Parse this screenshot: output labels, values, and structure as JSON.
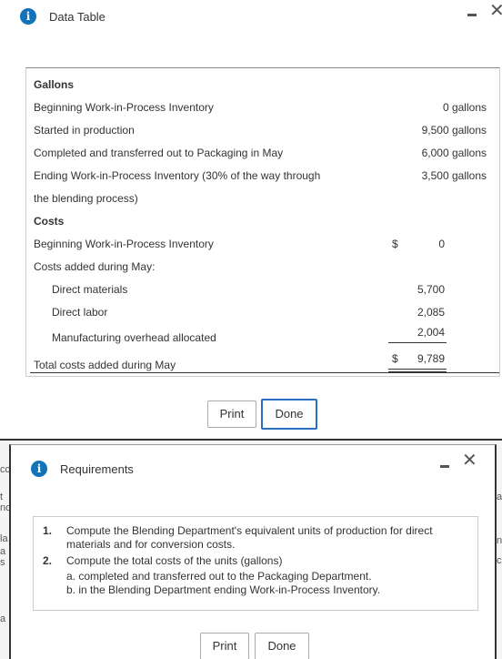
{
  "data_table": {
    "title": "Data Table",
    "sections": {
      "gallons_header": "Gallons",
      "costs_header": "Costs"
    },
    "rows": {
      "beginning_wip": {
        "label": "Beginning Work-in-Process Inventory",
        "value": "0 gallons"
      },
      "started": {
        "label": "Started in production",
        "value": "9,500 gallons"
      },
      "completed": {
        "label": "Completed and transferred out to Packaging in May",
        "value": "6,000 gallons"
      },
      "ending_wip_line1": "Ending Work-in-Process Inventory (30% of the way through",
      "ending_wip_line2": "the blending process)",
      "ending_wip_value": "3,500 gallons",
      "costs_beginning_label": "Beginning Work-in-Process Inventory",
      "costs_beginning_dollar": "$",
      "costs_beginning_value": "0",
      "costs_added_label": "Costs added during May:",
      "direct_materials": {
        "label": "Direct materials",
        "value": "5,700"
      },
      "direct_labor": {
        "label": "Direct labor",
        "value": "2,085"
      },
      "mfg_overhead": {
        "label": "Manufacturing overhead allocated",
        "value": "2,004"
      },
      "total": {
        "label": "Total costs added during May",
        "dollar": "$",
        "value": "9,789"
      }
    },
    "buttons": {
      "print": "Print",
      "done": "Done"
    }
  },
  "requirements": {
    "title": "Requirements",
    "items": [
      {
        "num": "1.",
        "line1": "Compute the Blending Department's equivalent units of production for direct",
        "line2": "materials and for conversion costs."
      },
      {
        "num": "2.",
        "line1": "Compute the total costs of the units (gallons)",
        "sub_a": "a. completed and transferred out to the Packaging Department.",
        "sub_b": "b. in the Blending Department ending Work-in-Process Inventory."
      }
    ],
    "buttons": {
      "print": "Print",
      "done": "Done"
    }
  },
  "icons": {
    "info": "info-icon",
    "minimize": "minimize-icon",
    "close": "close-icon"
  },
  "colors": {
    "info_blue": "#1473b8",
    "focus_blue": "#2a6fc1"
  }
}
